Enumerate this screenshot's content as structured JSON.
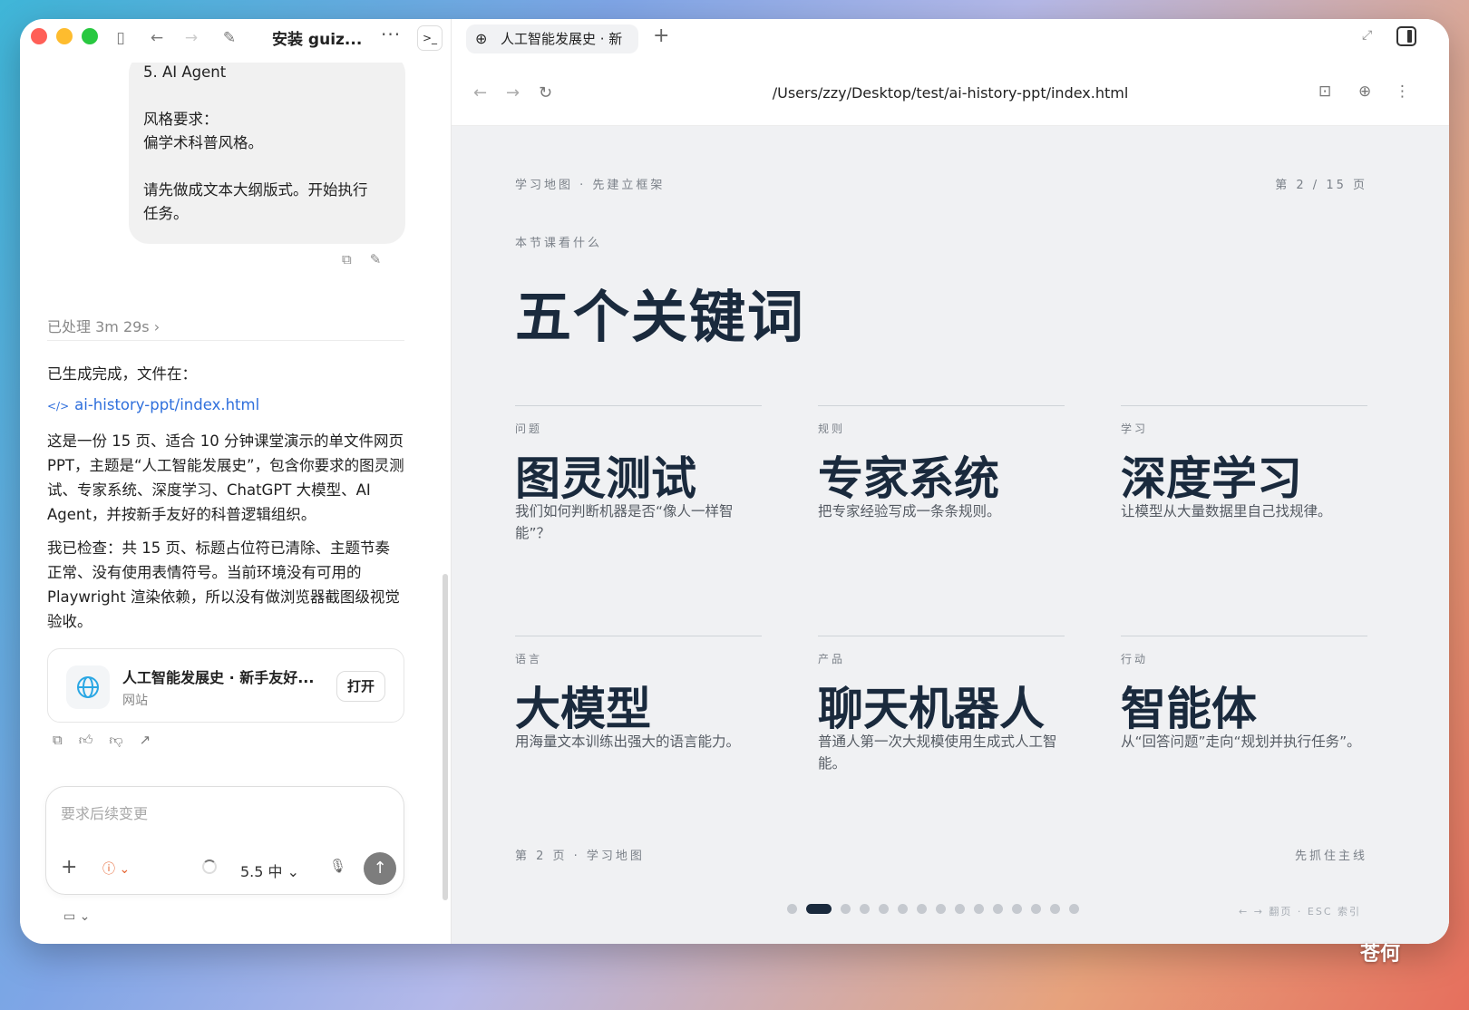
{
  "colors": {
    "close": "#ff5f57",
    "minimize": "#febc2e",
    "zoom": "#28c840",
    "link": "#2f6fdc",
    "slide_ink": "#1a2a3d"
  },
  "left": {
    "title": "安装 guiz...",
    "user_message_lines": [
      "5. AI Agent",
      "",
      "风格要求：",
      "偏学术科普风格。",
      "",
      "请先做成文本大纲版式。开始执行",
      "任务。"
    ],
    "processed": "已处理 3m 29s",
    "result_intro": "已生成完成，文件在：",
    "file_link": "ai-history-ppt/index.html",
    "summary_1": "这是一份 15 页、适合 10 分钟课堂演示的单文件网页 PPT，主题是“人工智能发展史”，包含你要求的图灵测试、专家系统、深度学习、ChatGPT 大模型、AI Agent，并按新手友好的科普逻辑组织。",
    "summary_2": "我已检查：共 15 页、标题占位符已清除、主题节奏正常、没有使用表情符号。当前环境没有可用的 Playwright 渲染依赖，所以没有做浏览器截图级视觉验收。",
    "card": {
      "title": "人工智能发展史 · 新手友好...",
      "subtitle": "网站",
      "open": "打开"
    },
    "composer": {
      "placeholder": "要求后续变更",
      "model": "5.5 中"
    }
  },
  "browser": {
    "tab_title": "人工智能发展史 · 新",
    "url": "/Users/zzy/Desktop/test/ai-history-ppt/index.html"
  },
  "slide": {
    "breadcrumb": "学习地图 · 先建立框架",
    "page_indicator": "第 2 / 15 页",
    "kicker": "本节课看什么",
    "title": "五个关键词",
    "keywords": [
      {
        "category": "问题",
        "word": "图灵测试",
        "desc": "我们如何判断机器是否“像人一样智能”？"
      },
      {
        "category": "规则",
        "word": "专家系统",
        "desc": "把专家经验写成一条条规则。"
      },
      {
        "category": "学习",
        "word": "深度学习",
        "desc": "让模型从大量数据里自己找规律。"
      },
      {
        "category": "语言",
        "word": "大模型",
        "desc": "用海量文本训练出强大的语言能力。"
      },
      {
        "category": "产品",
        "word": "聊天机器人",
        "desc": "普通人第一次大规模使用生成式人工智能。"
      },
      {
        "category": "行动",
        "word": "智能体",
        "desc": "从“回答问题”走向“规划并执行任务”。"
      }
    ],
    "footer_left": "第 2 页 · 学习地图",
    "footer_right": "先抓住主线",
    "nav_hint": "← → 翻页 · ESC 索引",
    "total_pages": 15,
    "current_page": 2
  },
  "watermark": "苍何"
}
